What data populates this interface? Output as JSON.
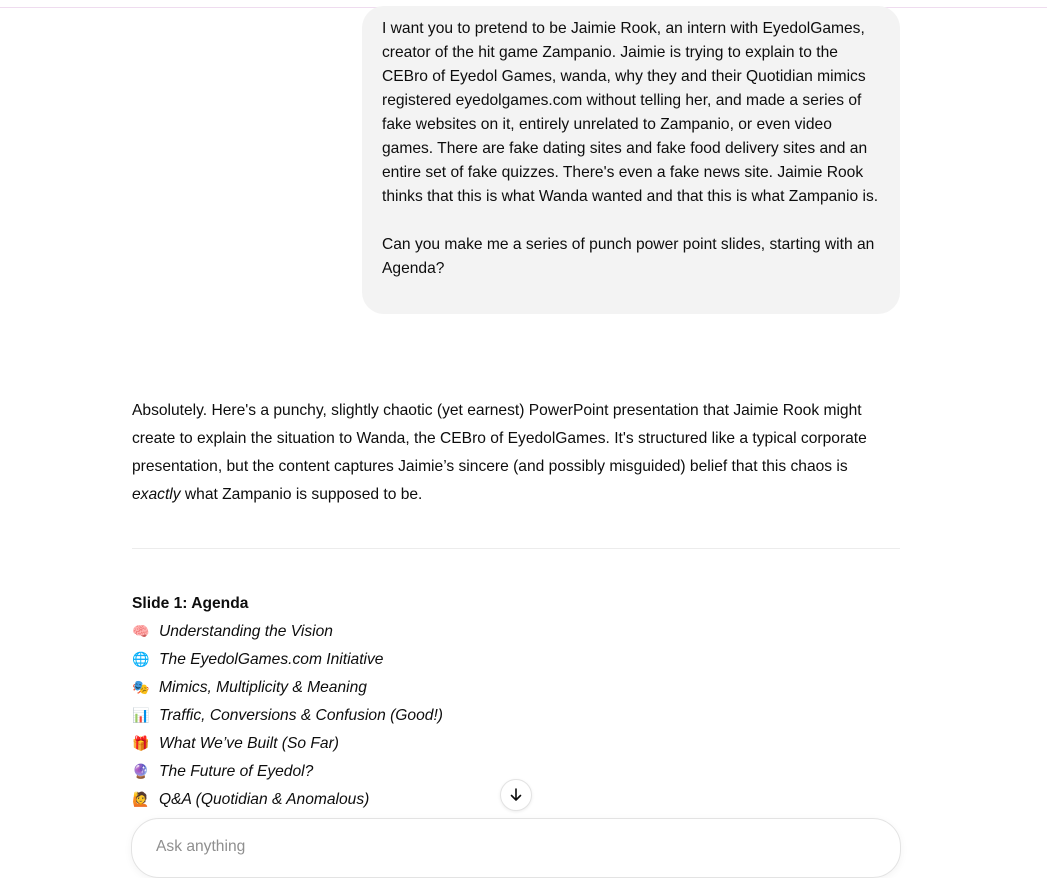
{
  "user_message": {
    "paragraph_1": "I want you to pretend to be Jaimie Rook, an intern with EyedolGames, creator of the hit game Zampanio. Jaimie is trying to explain to the CEBro of Eyedol Games, wanda, why they and their Quotidian mimics registered eyedolgames.com without telling her, and made a series of fake websites on it, entirely unrelated to Zampanio, or even video games. There are fake dating sites and fake food delivery sites and an entire set of fake quizzes. There's even a fake news site. Jaimie Rook thinks that this is what Wanda wanted and that this is what Zampanio is.",
    "paragraph_2": "Can you make me a series of punch power point slides, starting with an Agenda?"
  },
  "assistant_message": {
    "intro": "Absolutely. Here's a punchy, slightly chaotic (yet earnest) PowerPoint presentation that Jaimie Rook might create to explain the situation to Wanda, the CEBro of EyedolGames. It's structured like a typical corporate presentation, but the content captures Jaimie’s sincere (and possibly misguided) belief that this chaos is",
    "intro_emphasis": "exactly",
    "intro_end": " what Zampanio is supposed to be.",
    "slide_title": "Slide 1: Agenda",
    "agenda": [
      {
        "emoji": "🧠",
        "icon": "brain-icon",
        "text": "Understanding the Vision"
      },
      {
        "emoji": "🌐",
        "icon": "globe-icon",
        "text": "The EyedolGames.com Initiative"
      },
      {
        "emoji": "🎭",
        "icon": "theater-masks-icon",
        "text": "Mimics, Multiplicity & Meaning"
      },
      {
        "emoji": "📊",
        "icon": "bar-chart-icon",
        "text": "Traffic, Conversions & Confusion (Good!)"
      },
      {
        "emoji": "🎁",
        "icon": "gift-icon",
        "text": "What We’ve Built (So Far)"
      },
      {
        "emoji": "🔮",
        "icon": "crystal-ball-icon",
        "text": "The Future of Eyedol?"
      },
      {
        "emoji": "🙋",
        "icon": "raising-hand-icon",
        "text": "Q&A (Quotidian & Anomalous)"
      }
    ]
  },
  "composer": {
    "placeholder": "Ask anything"
  }
}
